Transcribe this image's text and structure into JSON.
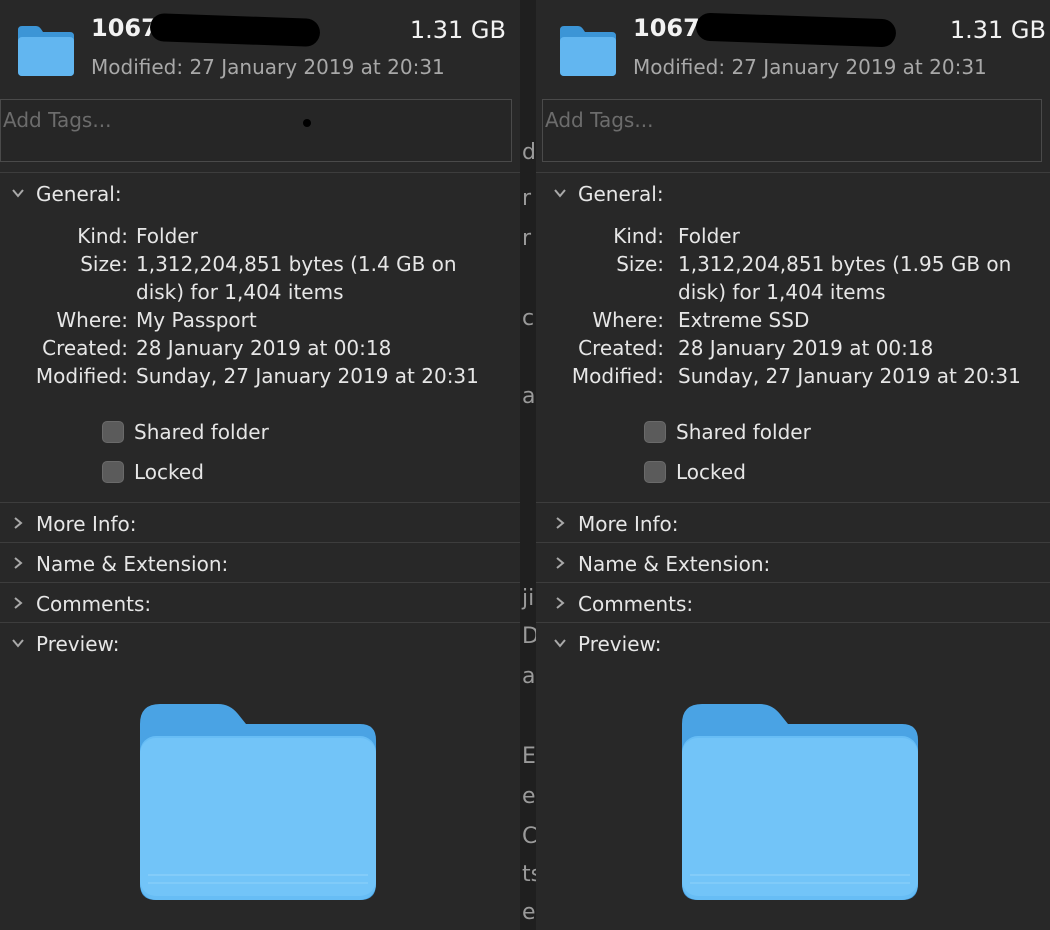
{
  "panels": [
    {
      "name": "1067-",
      "size": "1.31 GB",
      "modified_header": "Modified: 27 January 2019 at 20:31",
      "tags_placeholder": "Add Tags...",
      "general": {
        "title": "General:",
        "rows": [
          {
            "label": "Kind:",
            "value": "Folder"
          },
          {
            "label": "Size:",
            "value": "1,312,204,851 bytes (1.4 GB on"
          },
          {
            "label": "",
            "value": "disk) for 1,404 items"
          },
          {
            "label": "Where:",
            "value": "My Passport"
          },
          {
            "label": "Created:",
            "value": "28 January 2019 at 00:18"
          },
          {
            "label": "Modified:",
            "value": "Sunday, 27 January 2019 at 20:31"
          }
        ],
        "shared_folder": "Shared folder",
        "locked": "Locked"
      },
      "sections": [
        "More Info:",
        "Name & Extension:",
        "Comments:"
      ],
      "preview": "Preview:"
    },
    {
      "name": "1067-",
      "size": "1.31 GB",
      "modified_header": "Modified: 27 January 2019 at 20:31",
      "tags_placeholder": "Add Tags...",
      "general": {
        "title": "General:",
        "rows": [
          {
            "label": "Kind:",
            "value": "Folder"
          },
          {
            "label": "Size:",
            "value": "1,312,204,851 bytes (1.95 GB on"
          },
          {
            "label": "",
            "value": "disk) for 1,404 items"
          },
          {
            "label": "Where:",
            "value": "Extreme SSD"
          },
          {
            "label": "Created:",
            "value": "28 January 2019 at 00:18"
          },
          {
            "label": "Modified:",
            "value": "Sunday, 27 January 2019 at 20:31"
          }
        ],
        "shared_folder": "Shared folder",
        "locked": "Locked"
      },
      "sections": [
        "More Info:",
        "Name & Extension:",
        "Comments:"
      ],
      "preview": "Preview:"
    }
  ],
  "background_fragments": [
    "d",
    "r",
    "r",
    "c",
    "a",
    "ji",
    "D",
    "a",
    "E",
    "e",
    "C",
    "ts",
    "e"
  ],
  "icons": {
    "folder": "folder-icon",
    "collapse": "chevron-down-icon",
    "expand": "chevron-right-icon"
  },
  "colors": {
    "panel_bg": "#282828",
    "folder_blue": "#62b6f0"
  }
}
